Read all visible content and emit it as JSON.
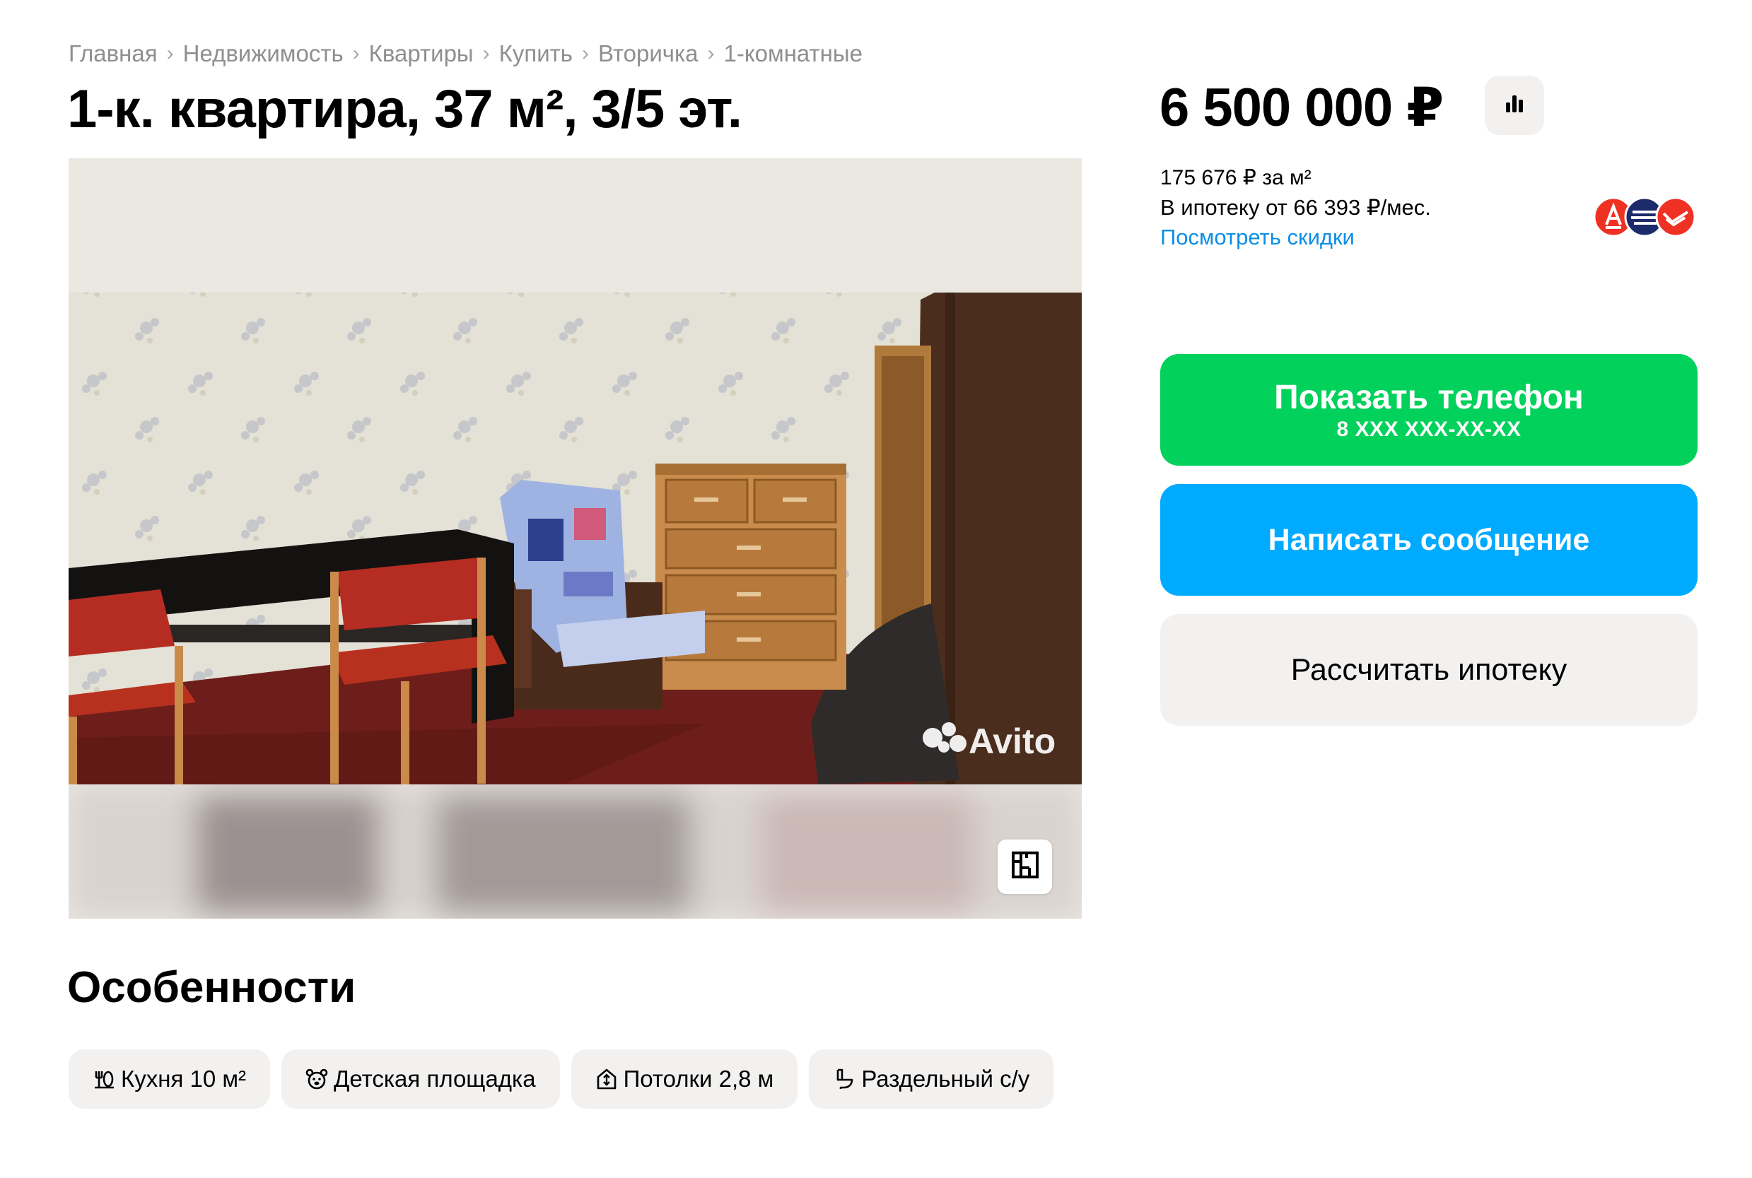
{
  "breadcrumbs": [
    "Главная",
    "Недвижимость",
    "Квартиры",
    "Купить",
    "Вторичка",
    "1-комнатные"
  ],
  "breadcrumb_separator": "›",
  "listing": {
    "title": "1-к. квартира, 37 м², 3/5 эт.",
    "watermark": "Avito"
  },
  "features": {
    "title": "Особенности",
    "items": [
      {
        "label": "Кухня 10 м²",
        "icon": "kitchen-icon"
      },
      {
        "label": "Детская площадка",
        "icon": "playground-icon"
      },
      {
        "label": "Потолки 2,8 м",
        "icon": "ceiling-icon"
      },
      {
        "label": "Раздельный с/у",
        "icon": "bathroom-icon"
      }
    ]
  },
  "price": {
    "value": "6 500 000 ₽",
    "per_m2": "175 676 ₽ за м²",
    "mortgage": "В ипотеку от 66 393 ₽/мес.",
    "discounts_link": "Посмотреть скидки"
  },
  "actions": {
    "show_phone": "Показать телефон",
    "phone_mask": "8 XXX XXX-XX-XX",
    "write_message": "Написать сообщение",
    "calc_mortgage": "Рассчитать ипотеку"
  },
  "colors": {
    "green": "#02d15c",
    "blue": "#00aaff",
    "link": "#0a8ee8",
    "chip_bg": "#f2f1f0",
    "bank_red": "#ef3124",
    "bank_navy": "#1d2b6b"
  }
}
